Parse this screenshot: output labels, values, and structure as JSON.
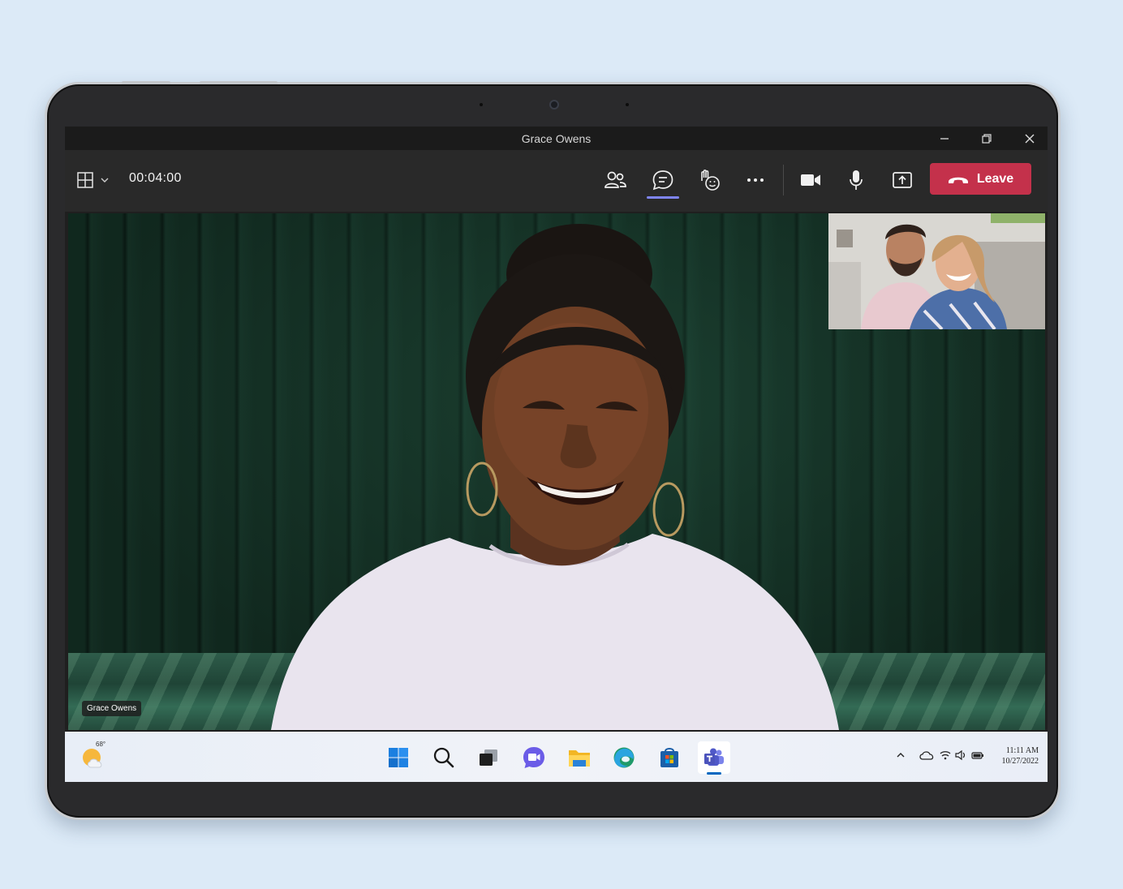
{
  "window": {
    "title": "Grace Owens"
  },
  "toolbar": {
    "timer": "00:04:00",
    "leave_label": "Leave",
    "active_tab": "chat"
  },
  "video": {
    "main_participant_name": "Grace Owens"
  },
  "taskbar": {
    "weather_temp": "68°",
    "apps": [
      "start",
      "search",
      "task-view",
      "chat",
      "file-explorer",
      "edge",
      "store",
      "teams"
    ],
    "active_app": "teams",
    "clock_time": "11:11 AM",
    "clock_date": "10/27/2022"
  },
  "colors": {
    "leave": "#c4314b",
    "accent": "#7f85f5",
    "background": "#dceaf7"
  }
}
